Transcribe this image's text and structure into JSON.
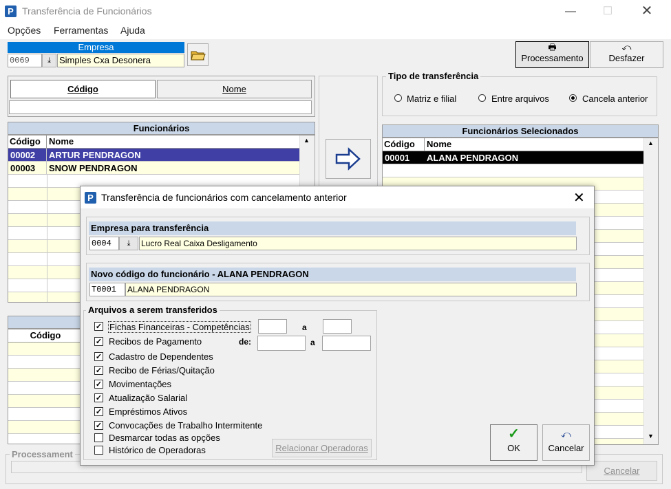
{
  "window": {
    "title": "Transferência de Funcionários",
    "app_icon": "P"
  },
  "menu": [
    "Opções",
    "Ferramentas",
    "Ajuda"
  ],
  "empresa": {
    "header": "Empresa",
    "code": "0069",
    "name": "Simples Cxa Desonera"
  },
  "toolbar": {
    "processamento": "Processamento",
    "desfazer": "Desfazer"
  },
  "search": {
    "tab_codigo": "Código",
    "tab_nome": "Nome",
    "value": ""
  },
  "funcionarios": {
    "header": "Funcionários",
    "col_codigo": "Código",
    "col_nome": "Nome",
    "rows": [
      {
        "codigo": "00002",
        "nome": "ARTUR PENDRAGON"
      },
      {
        "codigo": "00003",
        "nome": "SNOW PENDRAGON"
      }
    ]
  },
  "tipo": {
    "label": "Tipo de transferência",
    "options": [
      "Matriz e filial",
      "Entre arquivos",
      "Cancela anterior"
    ],
    "selected": "Cancela anterior"
  },
  "selecionados": {
    "header": "Funcionários Selecionados",
    "col_codigo": "Código",
    "col_nome": "Nome",
    "rows": [
      {
        "codigo": "00001",
        "nome": "ALANA PENDRAGON"
      }
    ]
  },
  "lower_grid": {
    "col_codigo": "Código"
  },
  "processamento_label": "Processament",
  "cancelar_main": "Cancelar",
  "dialog": {
    "title": "Transferência de funcionários com cancelamento anterior",
    "empresa_header": "Empresa para transferência",
    "empresa_code": "0004",
    "empresa_name": "Lucro Real Caixa Desligamento",
    "novo_header": "Novo código do funcionário - ALANA PENDRAGON",
    "novo_code": "T0001",
    "novo_name": "ALANA PENDRAGON",
    "arquivos_label": "Arquivos a serem transferidos",
    "checks": [
      {
        "label": "Fichas Financeiras - Competências",
        "checked": true
      },
      {
        "label": "Recibos de Pagamento",
        "checked": true
      },
      {
        "label": "Cadastro de Dependentes",
        "checked": true
      },
      {
        "label": "Recibo de Férias/Quitação",
        "checked": true
      },
      {
        "label": "Movimentações",
        "checked": true
      },
      {
        "label": "Atualização Salarial",
        "checked": true
      },
      {
        "label": "Empréstimos Ativos",
        "checked": true
      },
      {
        "label": "Convocações de Trabalho Intermitente",
        "checked": true
      },
      {
        "label": "Desmarcar todas as opções",
        "checked": false
      },
      {
        "label": "Histórico de Operadoras",
        "checked": false
      }
    ],
    "a_label": "a",
    "de_label": "de:",
    "relacionar": "Relacionar Operadoras",
    "ok": "OK",
    "cancelar": "Cancelar"
  }
}
